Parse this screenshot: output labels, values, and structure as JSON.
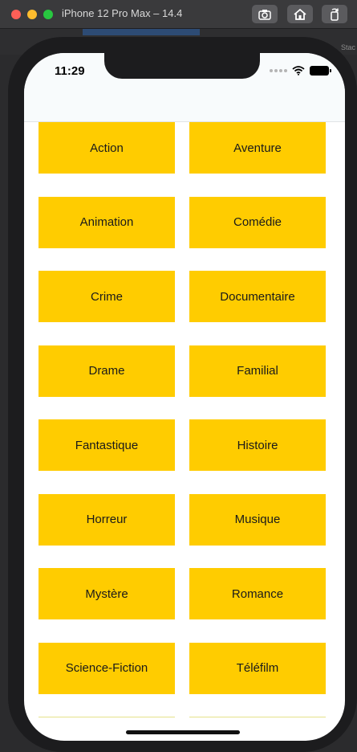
{
  "simulator": {
    "title": "iPhone 12 Pro Max – 14.4",
    "background_label": "Stac"
  },
  "status_bar": {
    "time": "11:29"
  },
  "genres": [
    {
      "label": "Action"
    },
    {
      "label": "Aventure"
    },
    {
      "label": "Animation"
    },
    {
      "label": "Comédie"
    },
    {
      "label": "Crime"
    },
    {
      "label": "Documentaire"
    },
    {
      "label": "Drame"
    },
    {
      "label": "Familial"
    },
    {
      "label": "Fantastique"
    },
    {
      "label": "Histoire"
    },
    {
      "label": "Horreur"
    },
    {
      "label": "Musique"
    },
    {
      "label": "Mystère"
    },
    {
      "label": "Romance"
    },
    {
      "label": "Science-Fiction"
    },
    {
      "label": "Téléfilm"
    }
  ],
  "colors": {
    "button": "#ffcc00",
    "button_text": "#1a1a1a",
    "screen_bg": "#ffffff"
  }
}
